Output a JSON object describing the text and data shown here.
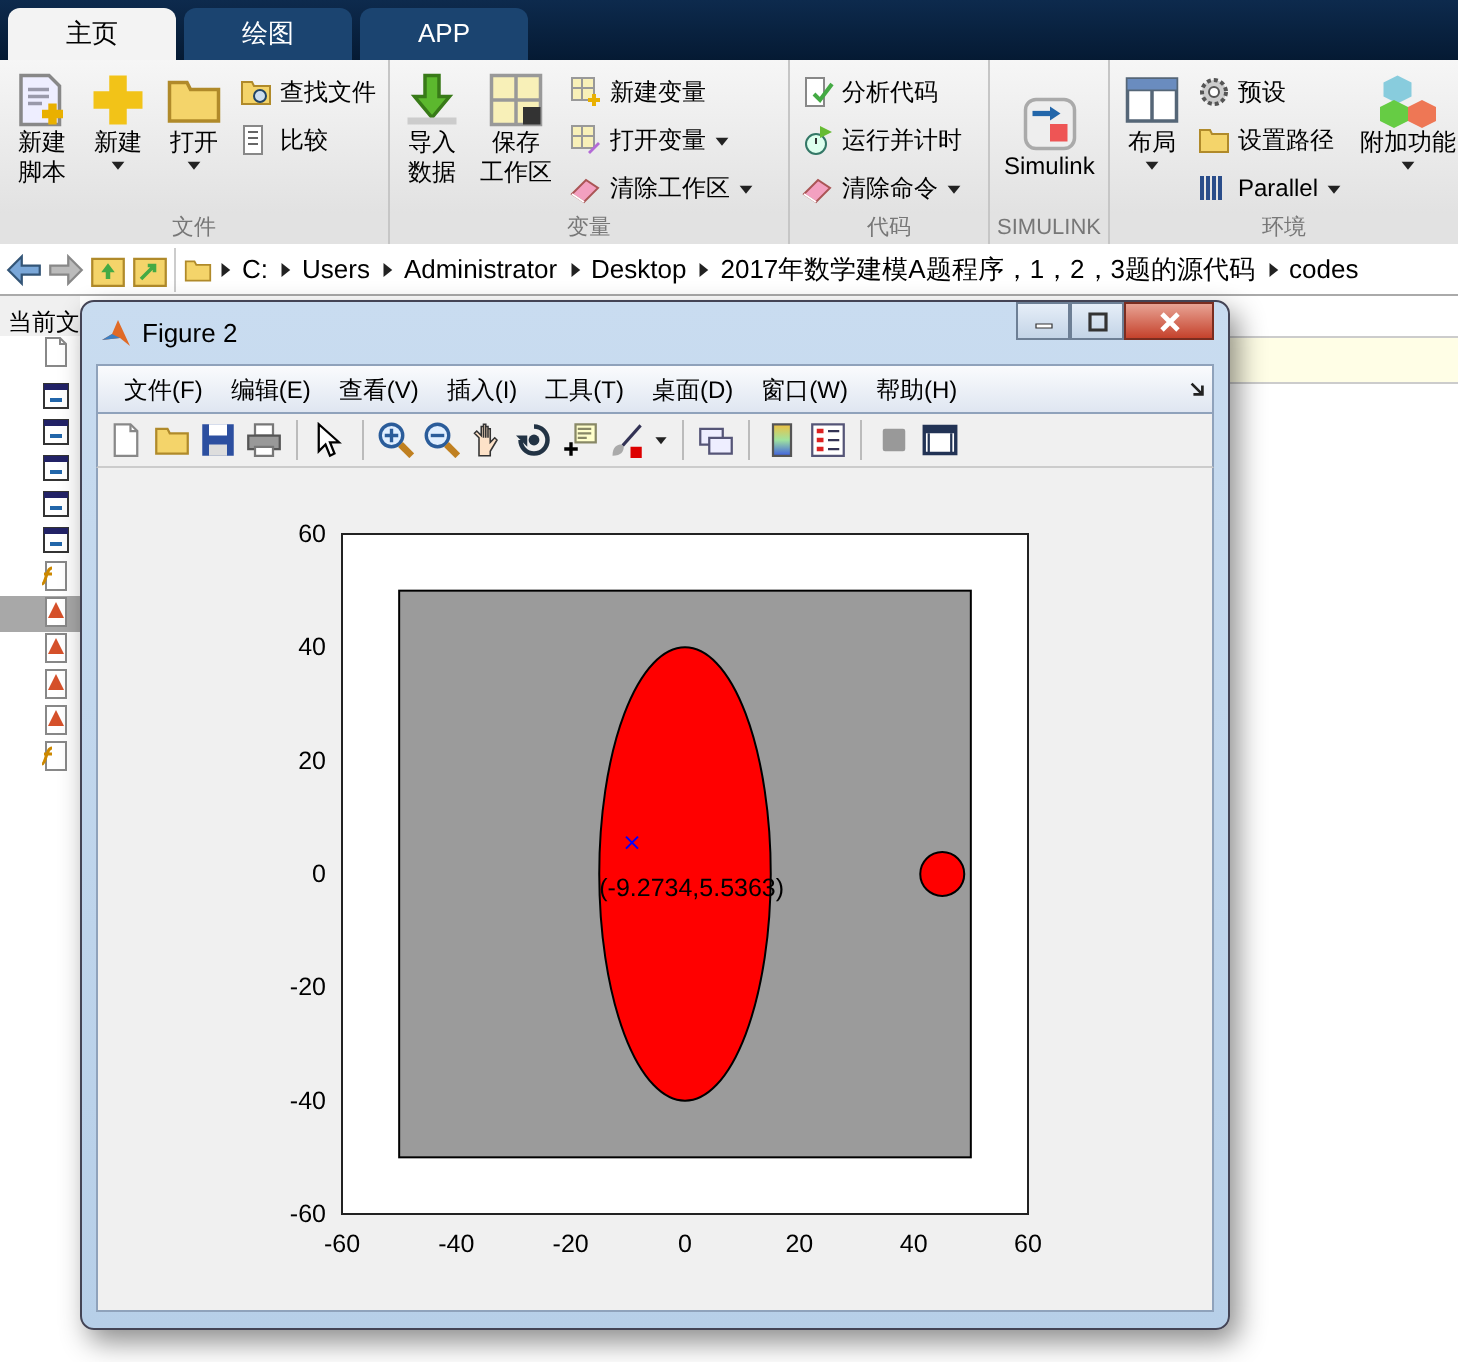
{
  "tabs": [
    {
      "label": "主页",
      "selected": true
    },
    {
      "label": "绘图",
      "selected": false
    },
    {
      "label": "APP",
      "selected": false
    }
  ],
  "ribbon_groups": [
    {
      "label": "文件",
      "items": [
        {
          "kind": "large",
          "lines": [
            "新建",
            "脚本"
          ],
          "dropdown": false
        },
        {
          "kind": "large",
          "lines": [
            "新建"
          ],
          "dropdown": true
        },
        {
          "kind": "large",
          "lines": [
            "打开"
          ],
          "dropdown": true
        },
        {
          "kind": "stack",
          "rows": [
            {
              "label": "查找文件",
              "dropdown": false
            },
            {
              "label": "比较",
              "dropdown": false
            }
          ]
        }
      ]
    },
    {
      "label": "变量",
      "items": [
        {
          "kind": "large",
          "lines": [
            "导入",
            "数据"
          ],
          "dropdown": false
        },
        {
          "kind": "large",
          "lines": [
            "保存",
            "工作区"
          ],
          "dropdown": false
        },
        {
          "kind": "stack",
          "rows": [
            {
              "label": "新建变量",
              "dropdown": false
            },
            {
              "label": "打开变量",
              "dropdown": true
            },
            {
              "label": "清除工作区",
              "dropdown": true
            }
          ]
        }
      ]
    },
    {
      "label": "代码",
      "items": [
        {
          "kind": "stack",
          "rows": [
            {
              "label": "分析代码",
              "dropdown": false
            },
            {
              "label": "运行并计时",
              "dropdown": false
            },
            {
              "label": "清除命令",
              "dropdown": true
            }
          ]
        }
      ]
    },
    {
      "label": "SIMULINK",
      "items": [
        {
          "kind": "large",
          "lines": [
            "Simulink"
          ],
          "dropdown": false
        }
      ]
    },
    {
      "label": "环境",
      "items": [
        {
          "kind": "large",
          "lines": [
            "布局"
          ],
          "dropdown": true
        },
        {
          "kind": "stack",
          "rows": [
            {
              "label": "预设",
              "dropdown": false
            },
            {
              "label": "设置路径",
              "dropdown": false
            },
            {
              "label": "Parallel",
              "dropdown": true
            }
          ]
        },
        {
          "kind": "large",
          "lines": [
            "附加功能"
          ],
          "dropdown": true
        }
      ]
    }
  ],
  "address_bar": {
    "crumbs": [
      "C:",
      "Users",
      "Administrator",
      "Desktop",
      "2017年数学建模A题程序，1，2，3题的源代码",
      "codes"
    ]
  },
  "current_folder": {
    "label": "当前文",
    "files": [
      {
        "kind": "app",
        "selected": false
      },
      {
        "kind": "app",
        "selected": false
      },
      {
        "kind": "app",
        "selected": false
      },
      {
        "kind": "app",
        "selected": false
      },
      {
        "kind": "app",
        "selected": false
      },
      {
        "kind": "function",
        "selected": false
      },
      {
        "kind": "script",
        "selected": true
      },
      {
        "kind": "script",
        "selected": false
      },
      {
        "kind": "script",
        "selected": false
      },
      {
        "kind": "script",
        "selected": false
      },
      {
        "kind": "function",
        "selected": false
      }
    ]
  },
  "figure_window": {
    "title": "Figure 2",
    "menus": [
      "文件(F)",
      "编辑(E)",
      "查看(V)",
      "插入(I)",
      "工具(T)",
      "桌面(D)",
      "窗口(W)",
      "帮助(H)"
    ],
    "plot": {
      "xticks": [
        "-60",
        "-40",
        "-20",
        "0",
        "20",
        "40",
        "60"
      ],
      "yticks": [
        "60",
        "40",
        "20",
        "0",
        "-20",
        "-40",
        "-60"
      ],
      "annotation": "(-9.2734,5.5363)"
    }
  }
}
